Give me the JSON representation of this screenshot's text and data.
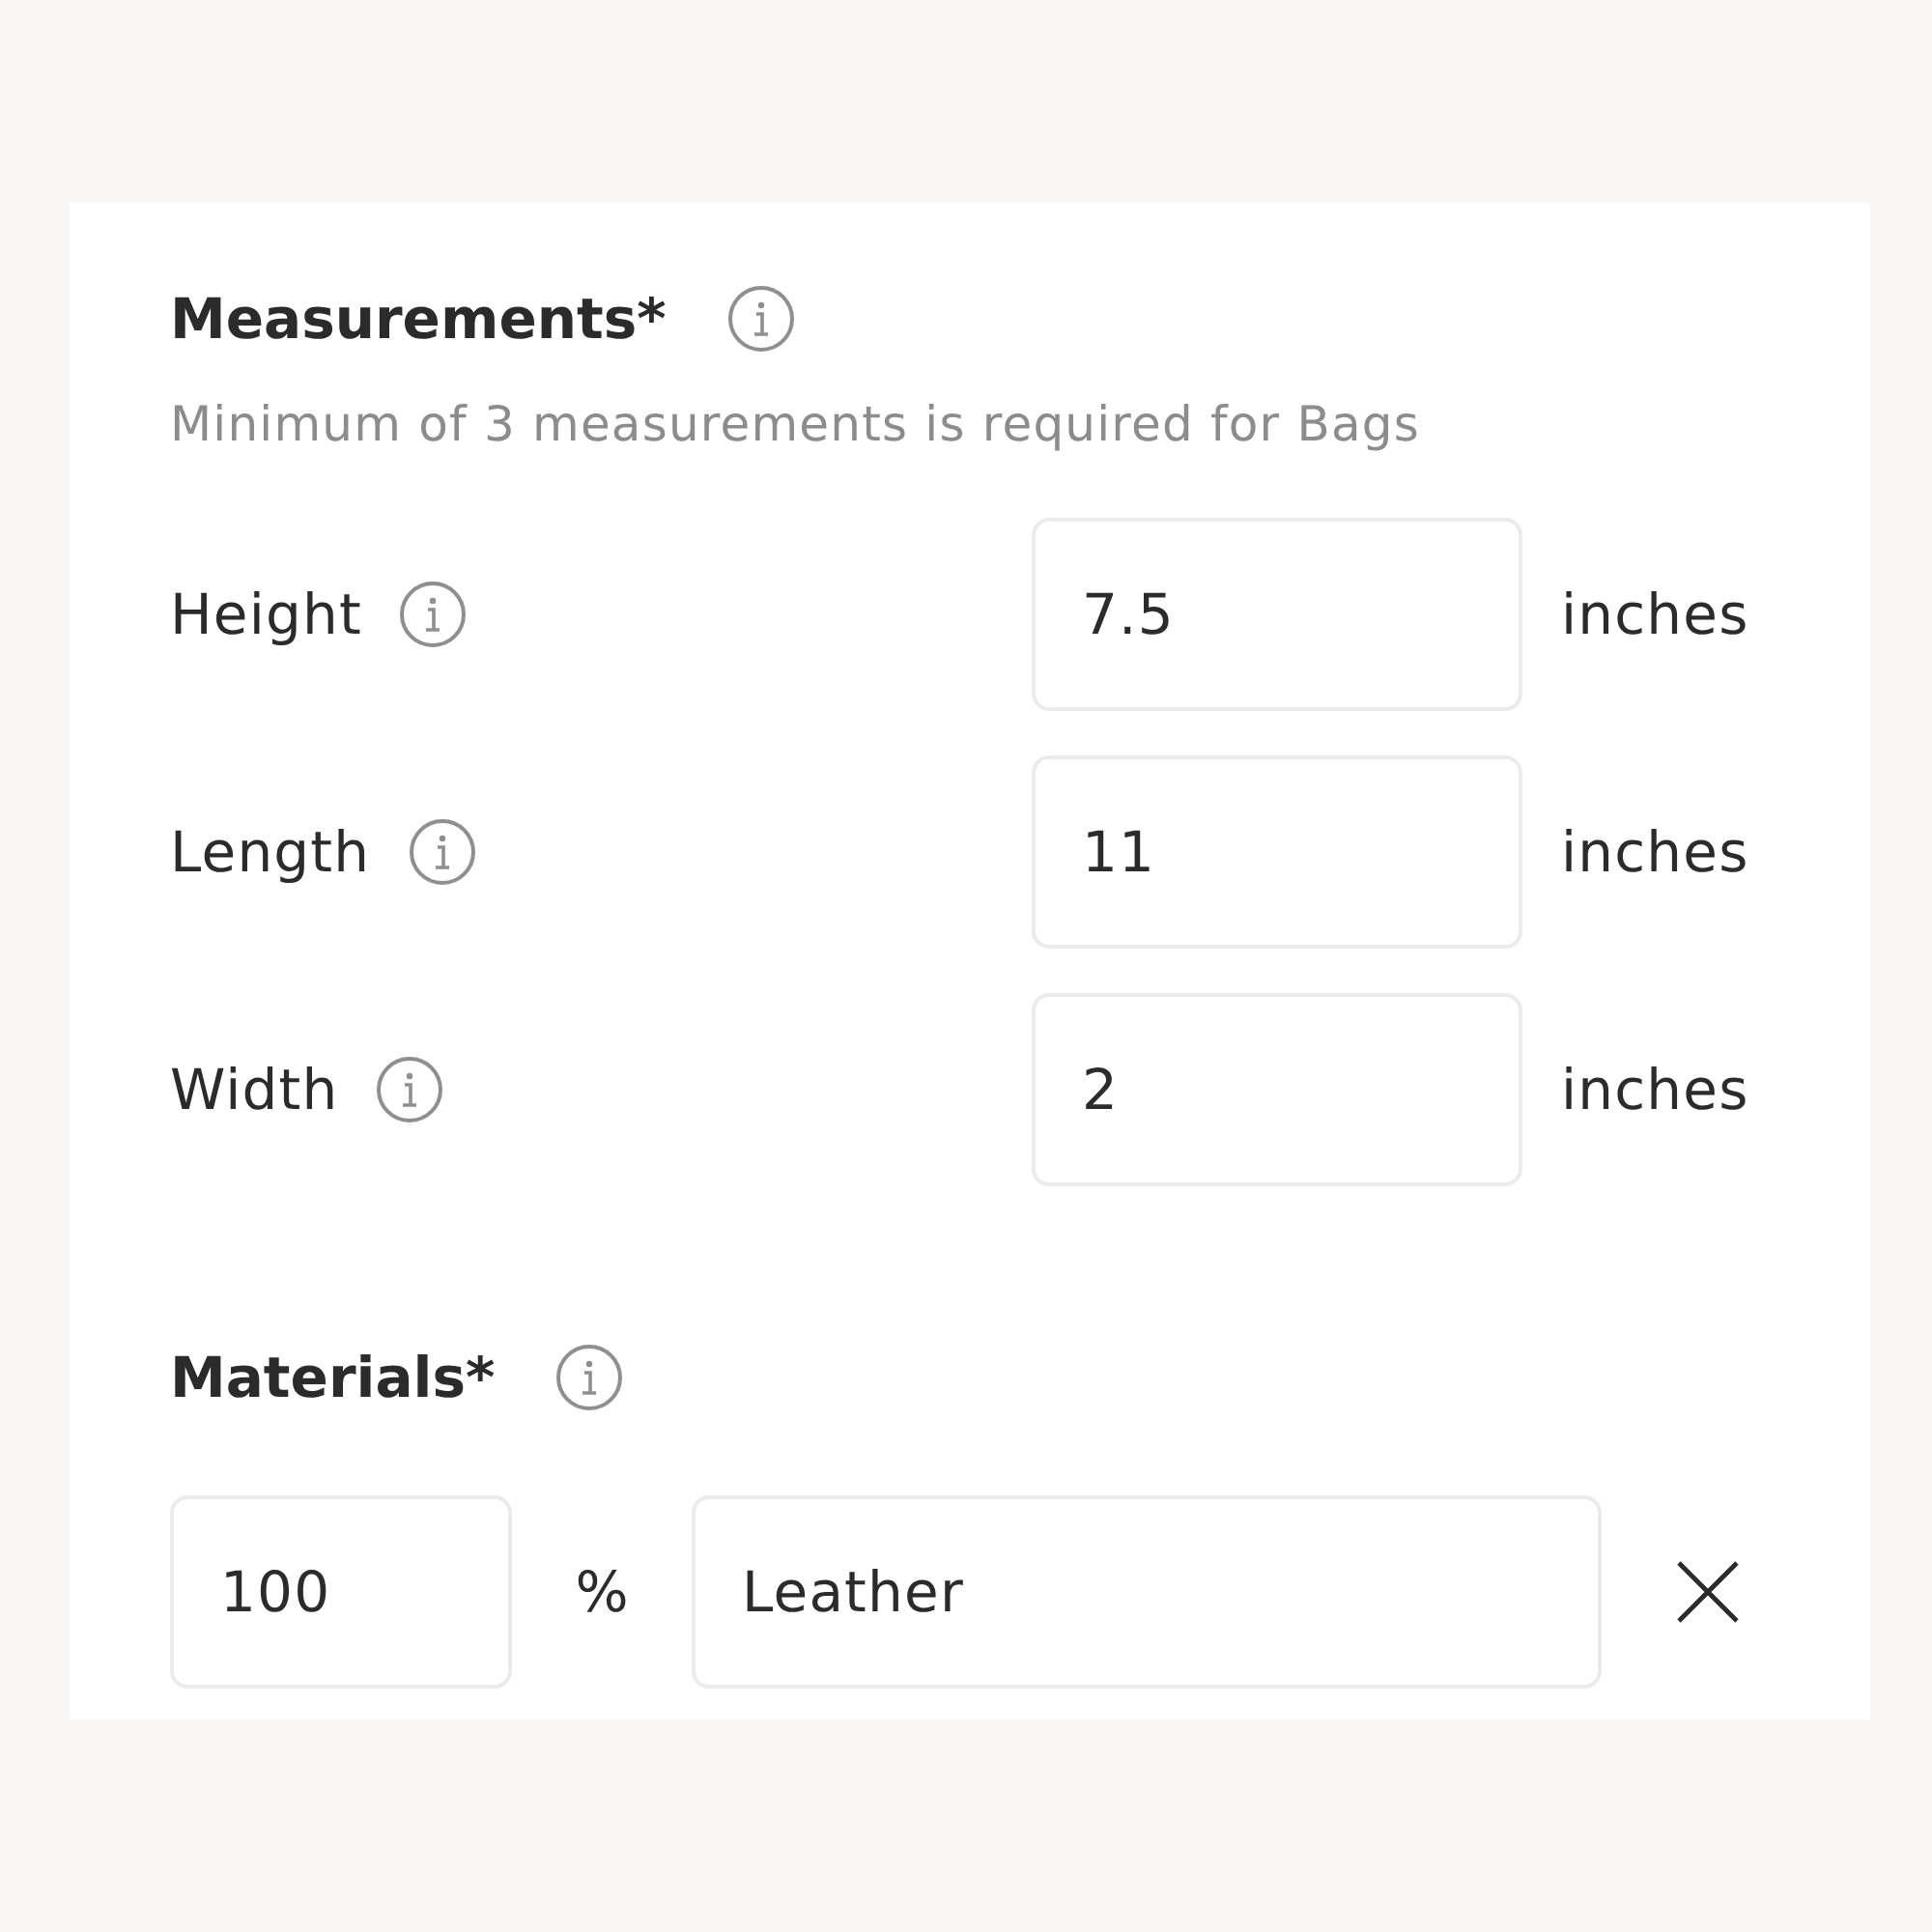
{
  "measurements": {
    "title": "Measurements*",
    "hint": "Minimum of 3 measurements is required for Bags",
    "rows": [
      {
        "label": "Height",
        "value": "7.5",
        "unit": "inches"
      },
      {
        "label": "Length",
        "value": "11",
        "unit": "inches"
      },
      {
        "label": "Width",
        "value": "2",
        "unit": "inches"
      }
    ]
  },
  "materials": {
    "title": "Materials*",
    "rows": [
      {
        "percent": "100",
        "unit": "%",
        "material": "Leather"
      }
    ]
  }
}
